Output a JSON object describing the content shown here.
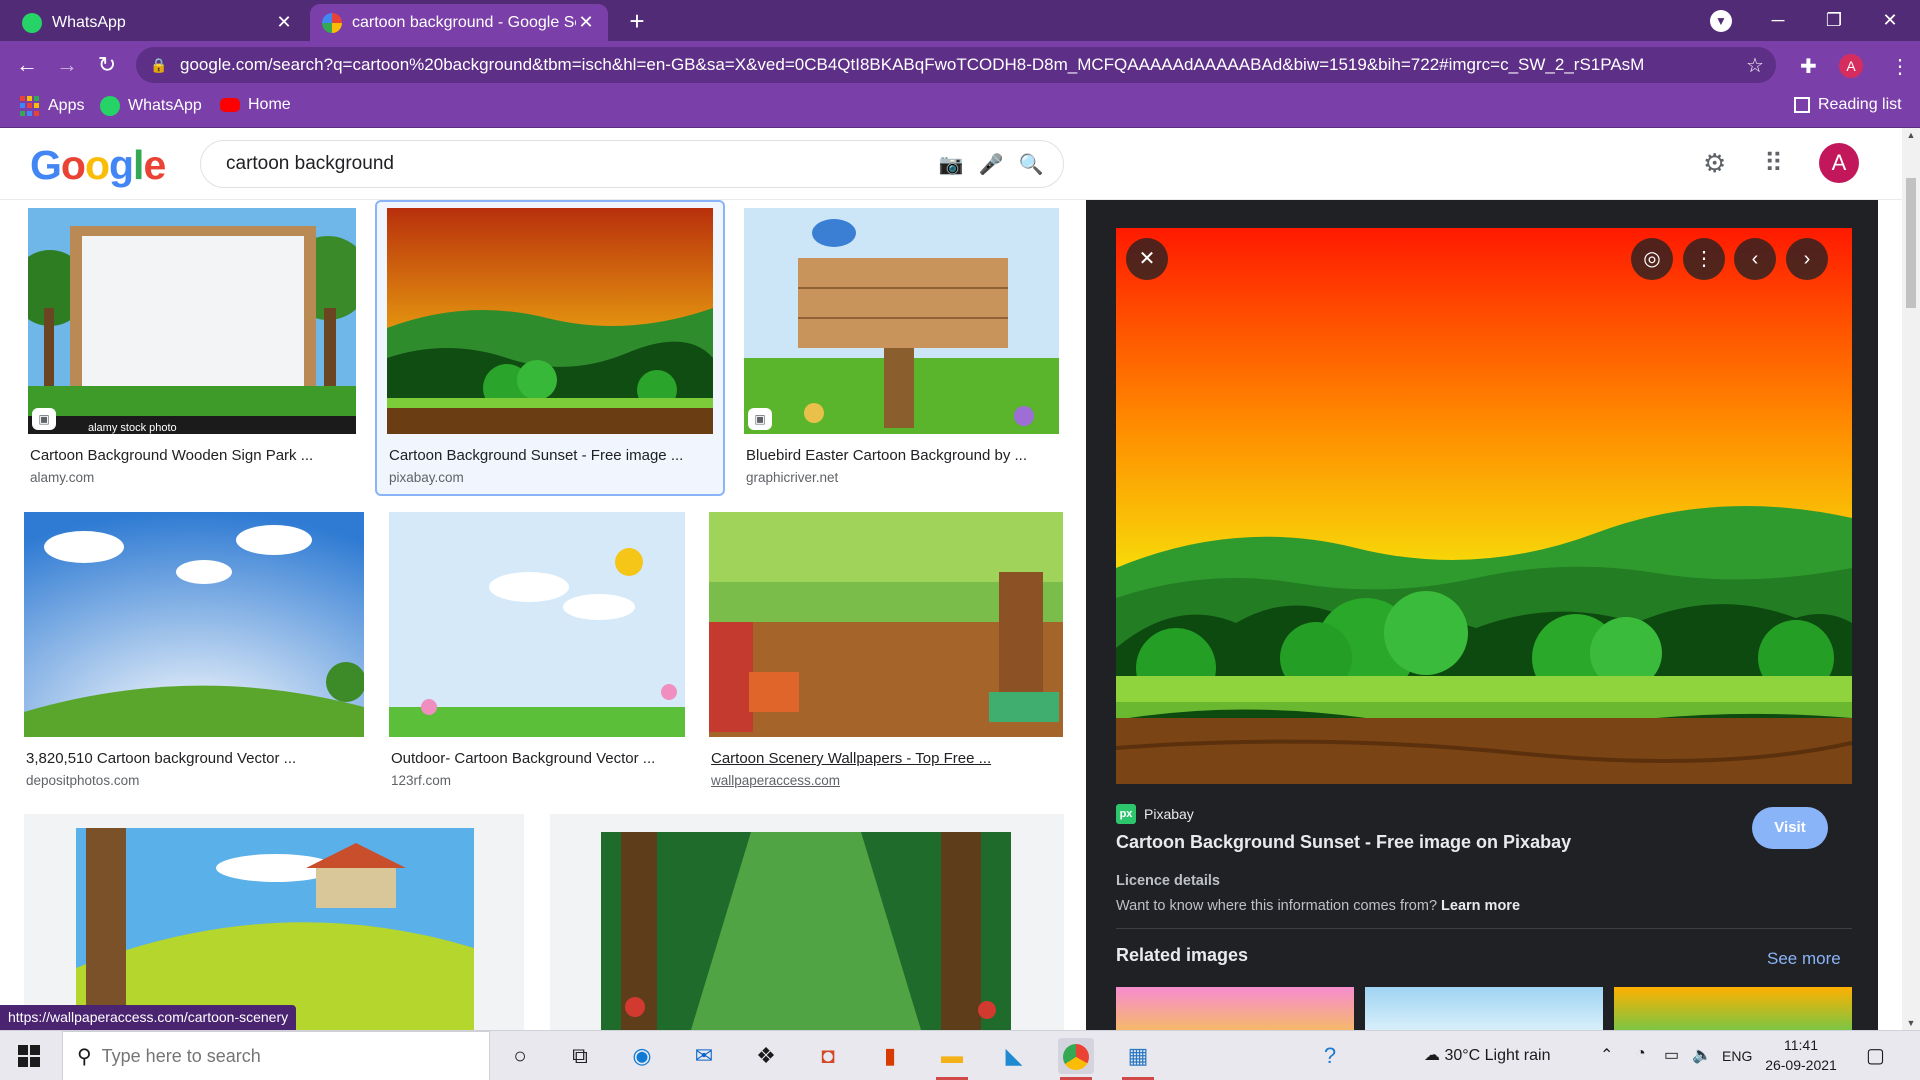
{
  "browser": {
    "tabs": [
      {
        "title": "WhatsApp",
        "active": false
      },
      {
        "title": "cartoon background - Google Se",
        "active": true
      }
    ],
    "url": "google.com/search?q=cartoon%20background&tbm=isch&hl=en-GB&sa=X&ved=0CB4QtI8BKABqFwoTCODH8-D8m_MCFQAAAAAdAAAAABAd&biw=1519&bih=722#imgrc=c_SW_2_rS1PAsM",
    "profile_initial": "A",
    "bookmarks": [
      "Apps",
      "WhatsApp",
      "Home"
    ],
    "reading_list": "Reading list"
  },
  "search": {
    "logo": [
      "G",
      "o",
      "o",
      "g",
      "l",
      "e"
    ],
    "query": "cartoon background",
    "account_initial": "A"
  },
  "results": [
    {
      "caption": "Cartoon Background Wooden Sign Park ...",
      "source": "alamy.com",
      "watermark": "alamy stock photo"
    },
    {
      "caption": "Cartoon Background Sunset - Free image ...",
      "source": "pixabay.com"
    },
    {
      "caption": "Bluebird Easter Cartoon Background by ...",
      "source": "graphicriver.net"
    },
    {
      "caption": "3,820,510 Cartoon background Vector ...",
      "source": "depositphotos.com"
    },
    {
      "caption": "Outdoor- Cartoon Background Vector ...",
      "source": "123rf.com"
    },
    {
      "caption": "Cartoon Scenery Wallpapers - Top Free ...",
      "source": "wallpaperaccess.com"
    }
  ],
  "panel": {
    "source_name": "Pixabay",
    "source_logo": "px",
    "title": "Cartoon Background Sunset - Free image on Pixabay",
    "visit_label": "Visit",
    "licence_heading": "Licence details",
    "licence_text": "Want to know where this information comes from?",
    "learn_more": "Learn more",
    "related_heading": "Related images",
    "see_more": "See more"
  },
  "status_url": "https://wallpaperaccess.com/cartoon-scenery",
  "taskbar": {
    "search_placeholder": "Type here to search",
    "weather": "30°C  Light rain",
    "language": "ENG",
    "time": "11:41",
    "date": "26-09-2021"
  },
  "colors": {
    "tab_strip": "#512b76",
    "toolbar": "#7b3fa9",
    "panel_bg": "#202124",
    "accent_blue": "#8ab4f8"
  }
}
